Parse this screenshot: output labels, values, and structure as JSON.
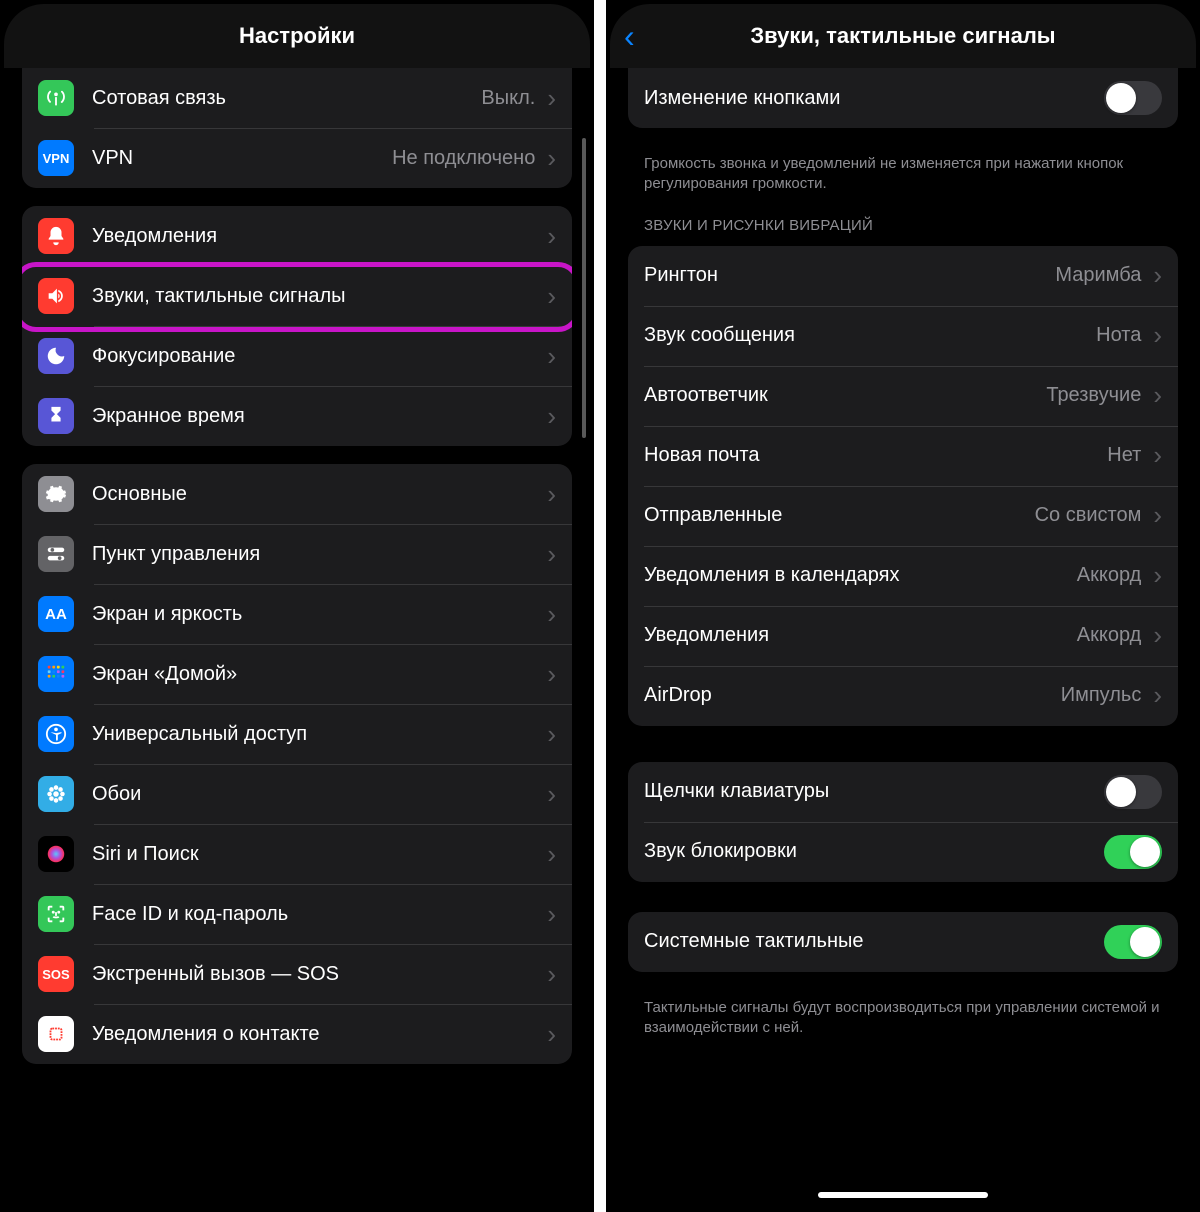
{
  "left": {
    "title": "Настройки",
    "group1": [
      {
        "icon": "antenna-icon",
        "bg": "bg-green",
        "label": "Сотовая связь",
        "value": "Выкл."
      },
      {
        "icon": "vpn-icon",
        "bg": "bg-blue",
        "label": "VPN",
        "value": "Не подключено"
      }
    ],
    "group2": [
      {
        "icon": "bell-icon",
        "bg": "bg-red",
        "label": "Уведомления"
      },
      {
        "icon": "speaker-icon",
        "bg": "bg-red",
        "label": "Звуки, тактильные сигналы",
        "highlight": true
      },
      {
        "icon": "moon-icon",
        "bg": "bg-purple",
        "label": "Фокусирование"
      },
      {
        "icon": "hourglass-icon",
        "bg": "bg-purple",
        "label": "Экранное время"
      }
    ],
    "group3": [
      {
        "icon": "gear-icon",
        "bg": "bg-gray",
        "label": "Основные"
      },
      {
        "icon": "switches-icon",
        "bg": "bg-gray2",
        "label": "Пункт управления"
      },
      {
        "icon": "aa-icon",
        "bg": "bg-blue",
        "label": "Экран и яркость"
      },
      {
        "icon": "grid-icon",
        "bg": "bg-blue",
        "label": "Экран «Домой»"
      },
      {
        "icon": "accessibility-icon",
        "bg": "bg-blue",
        "label": "Универсальный доступ"
      },
      {
        "icon": "flower-icon",
        "bg": "bg-cyan",
        "label": "Обои"
      },
      {
        "icon": "siri-icon",
        "bg": "bg-black",
        "label": "Siri и Поиск"
      },
      {
        "icon": "faceid-icon",
        "bg": "bg-green",
        "label": "Face ID и код-пароль"
      },
      {
        "icon": "sos-icon",
        "bg": "bg-red",
        "label": "Экстренный вызов — SOS"
      },
      {
        "icon": "contact-icon",
        "bg": "bg-pink",
        "label": "Уведомления о контакте"
      }
    ]
  },
  "right": {
    "title": "Звуки, тактильные сигналы",
    "top_row_label": "Изменение кнопками",
    "top_row_toggle": false,
    "top_footer": "Громкость звонка и уведомлений не изменяется при нажатии кнопок регулирования громкости.",
    "section_sounds_title": "ЗВУКИ И РИСУНКИ ВИБРАЦИЙ",
    "sounds": [
      {
        "label": "Рингтон",
        "value": "Маримба"
      },
      {
        "label": "Звук сообщения",
        "value": "Нота"
      },
      {
        "label": "Автоответчик",
        "value": "Трезвучие"
      },
      {
        "label": "Новая почта",
        "value": "Нет"
      },
      {
        "label": "Отправленные",
        "value": "Со свистом"
      },
      {
        "label": "Уведомления в календарях",
        "value": "Аккорд"
      },
      {
        "label": "Уведомления",
        "value": "Аккорд"
      },
      {
        "label": "AirDrop",
        "value": "Импульс"
      }
    ],
    "toggles1": [
      {
        "label": "Щелчки клавиатуры",
        "on": false
      },
      {
        "label": "Звук блокировки",
        "on": true
      }
    ],
    "toggles2": [
      {
        "label": "Системные тактильные",
        "on": true,
        "highlight": true
      }
    ],
    "bottom_footer": "Тактильные сигналы будут воспроизводиться при управлении системой и взаимодействии с ней."
  }
}
